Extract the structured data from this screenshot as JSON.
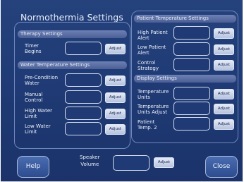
{
  "title": "Normothermia Settings",
  "left": {
    "therapy_header": "Therapy Settings",
    "timer_label": "Timer\nBegins",
    "water_header": "Water Temperature Settings",
    "precondition_label": "Pre-Condition\nWater",
    "manual_label": "Manual\nControl",
    "high_water_label": "High Water\nLimit",
    "low_water_label": "Low Water\nLimit"
  },
  "right": {
    "patient_temp_header": "Patient Temperature Settings",
    "high_patient_label": "High Patient\nAlert",
    "low_patient_label": "Low Patient\nAlert",
    "control_strategy_label": "Control\nStrategy",
    "display_header": "Display Settings",
    "temp_units_label": "Temperature\nUnits",
    "temp_units_adjust_label": "Temperature\nUnits Adjust",
    "patient_temp2_label": "Patient\nTemp. 2"
  },
  "bottom": {
    "speaker_volume_label": "Speaker\nVolume",
    "help_label": "Help",
    "close_label": "Close"
  },
  "common": {
    "adjust_label": "Adjust"
  }
}
